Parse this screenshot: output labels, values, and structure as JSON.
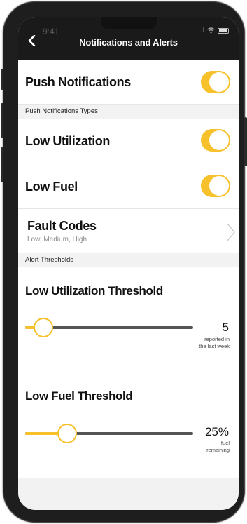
{
  "status": {
    "time": "9:41"
  },
  "header": {
    "title": "Notifications and Alerts"
  },
  "push": {
    "label": "Push Notifications",
    "enabled": true
  },
  "push_types_header": "Push Notifications Types",
  "low_utilization": {
    "label": "Low Utilization",
    "enabled": true
  },
  "low_fuel": {
    "label": "Low Fuel",
    "enabled": true
  },
  "fault_codes": {
    "label": "Fault Codes",
    "subtitle": "Low, Medium, High"
  },
  "alert_thresholds_header": "Alert Thresholds",
  "util_threshold": {
    "label": "Low Utilization Threshold",
    "value": "5",
    "description_line1": "reported in",
    "description_line2": "the last week",
    "slider_fraction": 0.11
  },
  "fuel_threshold": {
    "label": "Low Fuel Threshold",
    "value": "25%",
    "description_line1": "fuel",
    "description_line2": "remaining",
    "slider_fraction": 0.25
  },
  "colors": {
    "accent": "#f6c12a",
    "header_bg": "#1a1a1a",
    "track": "#555555"
  },
  "icons": {
    "back": "chevron-left-icon",
    "disclosure": "chevron-right-icon",
    "wifi": "wifi-icon",
    "battery": "battery-icon"
  }
}
